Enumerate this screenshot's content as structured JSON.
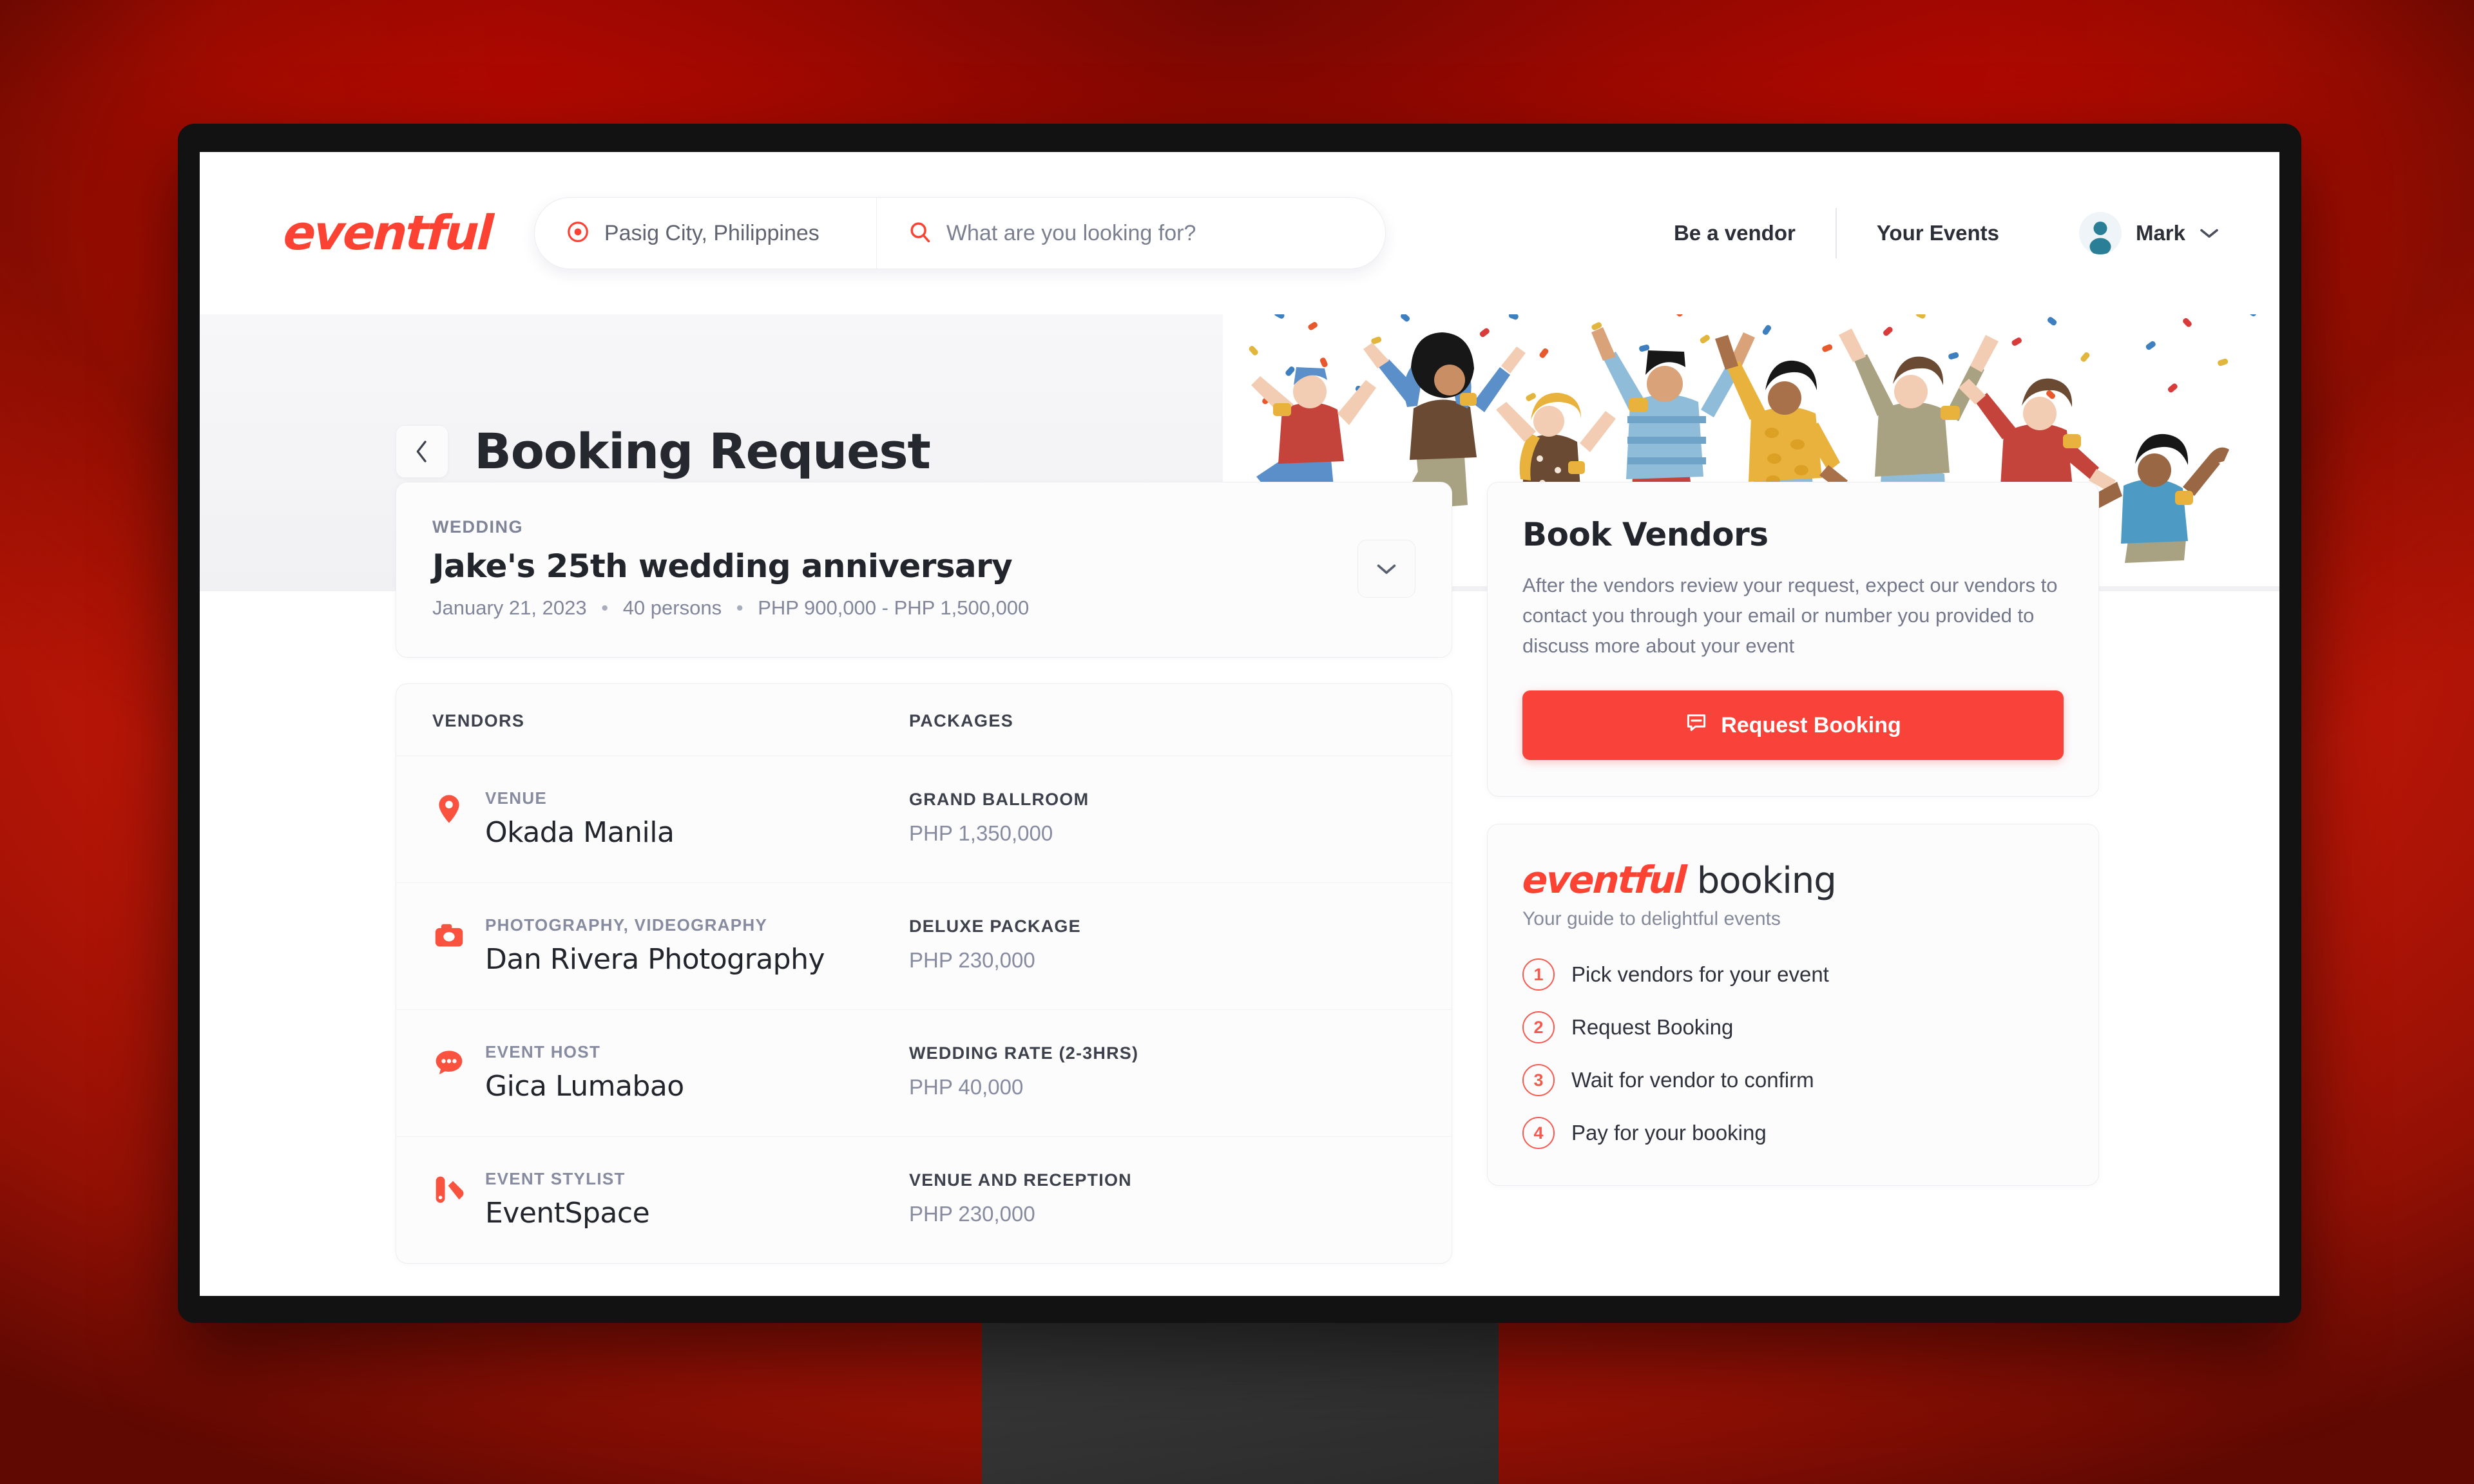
{
  "brand": {
    "name": "eventful",
    "accent": "#fb4233",
    "cta_color": "#f9423a"
  },
  "nav": {
    "location_value": "Pasig City, Philippines",
    "search_placeholder": "What are you looking for?",
    "be_a_vendor": "Be a vendor",
    "your_events": "Your Events",
    "user_name": "Mark"
  },
  "hero": {
    "page_title": "Booking Request",
    "back_label": "‹"
  },
  "event": {
    "kicker": "WEDDING",
    "title": "Jake's 25th wedding anniversary",
    "date": "January 21, 2023",
    "guests": "40 persons",
    "budget": "PHP 900,000 - PHP 1,500,000",
    "separator": "•"
  },
  "vendors_table": {
    "columns": [
      "VENDORS",
      "PACKAGES"
    ],
    "rows": [
      {
        "icon": "location-pin-icon",
        "category": "VENUE",
        "name": "Okada Manila",
        "package": "GRAND BALLROOM",
        "price": "PHP 1,350,000"
      },
      {
        "icon": "camera-icon",
        "category": "PHOTOGRAPHY, VIDEOGRAPHY",
        "name": "Dan Rivera Photography",
        "package": "DELUXE PACKAGE",
        "price": "PHP 230,000"
      },
      {
        "icon": "chat-bubble-icon",
        "category": "EVENT HOST",
        "name": "Gica Lumabao",
        "package": "WEDDING RATE (2-3HRS)",
        "price": "PHP 40,000"
      },
      {
        "icon": "stylist-palette-icon",
        "category": "EVENT STYLIST",
        "name": "EventSpace",
        "package": "VENUE AND RECEPTION",
        "price": "PHP 230,000"
      }
    ]
  },
  "book_vendors": {
    "title": "Book Vendors",
    "description": "After the vendors review your request, expect our vendors to contact you through your email or number you provided to discuss more about your event",
    "cta_label": "Request Booking"
  },
  "guide": {
    "logo": "eventful",
    "word": "booking",
    "subtitle": "Your guide to delightful events",
    "steps": [
      {
        "num": "1",
        "label": "Pick vendors for your event"
      },
      {
        "num": "2",
        "label": "Request Booking"
      },
      {
        "num": "3",
        "label": "Wait for vendor to confirm"
      },
      {
        "num": "4",
        "label": "Pay for your booking"
      }
    ]
  }
}
